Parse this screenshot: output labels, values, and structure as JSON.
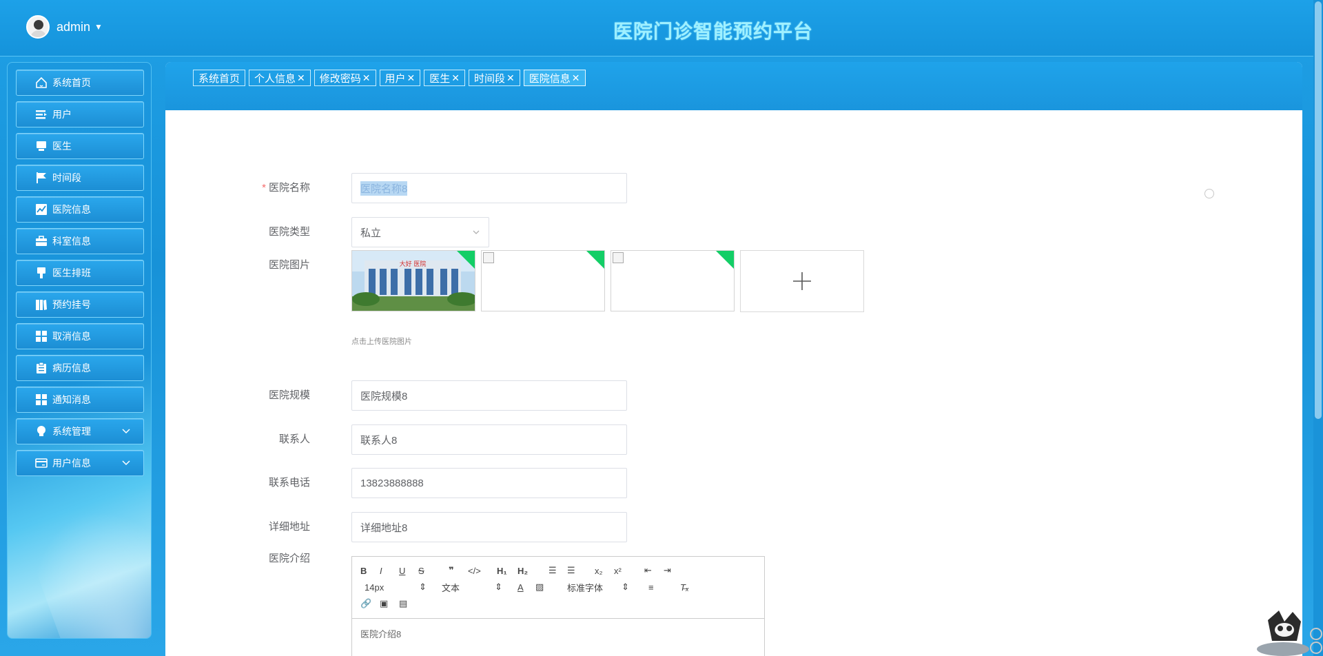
{
  "header": {
    "username": "admin",
    "title": "医院门诊智能预约平台"
  },
  "sidebar": {
    "items": [
      {
        "label": "系统首页",
        "icon": "home-icon"
      },
      {
        "label": "用户",
        "icon": "list-icon"
      },
      {
        "label": "医生",
        "icon": "monitor-icon"
      },
      {
        "label": "时间段",
        "icon": "flag-icon"
      },
      {
        "label": "医院信息",
        "icon": "chart-icon"
      },
      {
        "label": "科室信息",
        "icon": "briefcase-icon"
      },
      {
        "label": "医生排班",
        "icon": "pin-icon"
      },
      {
        "label": "预约挂号",
        "icon": "book-icon"
      },
      {
        "label": "取消信息",
        "icon": "grid-icon"
      },
      {
        "label": "病历信息",
        "icon": "clipboard-icon"
      },
      {
        "label": "通知消息",
        "icon": "grid-icon"
      },
      {
        "label": "系统管理",
        "icon": "bulb-icon"
      },
      {
        "label": "用户信息",
        "icon": "card-icon"
      }
    ]
  },
  "tabs": [
    {
      "label": "系统首页",
      "closable": false
    },
    {
      "label": "个人信息",
      "closable": true
    },
    {
      "label": "修改密码",
      "closable": true
    },
    {
      "label": "用户",
      "closable": true
    },
    {
      "label": "医生",
      "closable": true
    },
    {
      "label": "时间段",
      "closable": true
    },
    {
      "label": "医院信息",
      "closable": true,
      "active": true
    }
  ],
  "form": {
    "name": {
      "label": "医院名称",
      "value": "医院名称8"
    },
    "type": {
      "label": "医院类型",
      "value": "私立"
    },
    "images": {
      "label": "医院图片",
      "hint": "点击上传医院图片"
    },
    "scale": {
      "label": "医院规模",
      "value": "医院规模8"
    },
    "contact": {
      "label": "联系人",
      "value": "联系人8"
    },
    "phone": {
      "label": "联系电话",
      "value": "13823888888"
    },
    "address": {
      "label": "详细地址",
      "value": "详细地址8"
    },
    "intro": {
      "label": "医院介绍",
      "value": "医院介绍8"
    }
  },
  "editor_toolbar": {
    "font_size": "14px",
    "format": "文本",
    "font_family": "标准字体"
  },
  "building_sign": "大好 医院",
  "colors": {
    "primary": "#1a95dd",
    "accent_title": "#9ff0ff",
    "corner_badge": "#13ce66",
    "required": "#f56c6c"
  }
}
